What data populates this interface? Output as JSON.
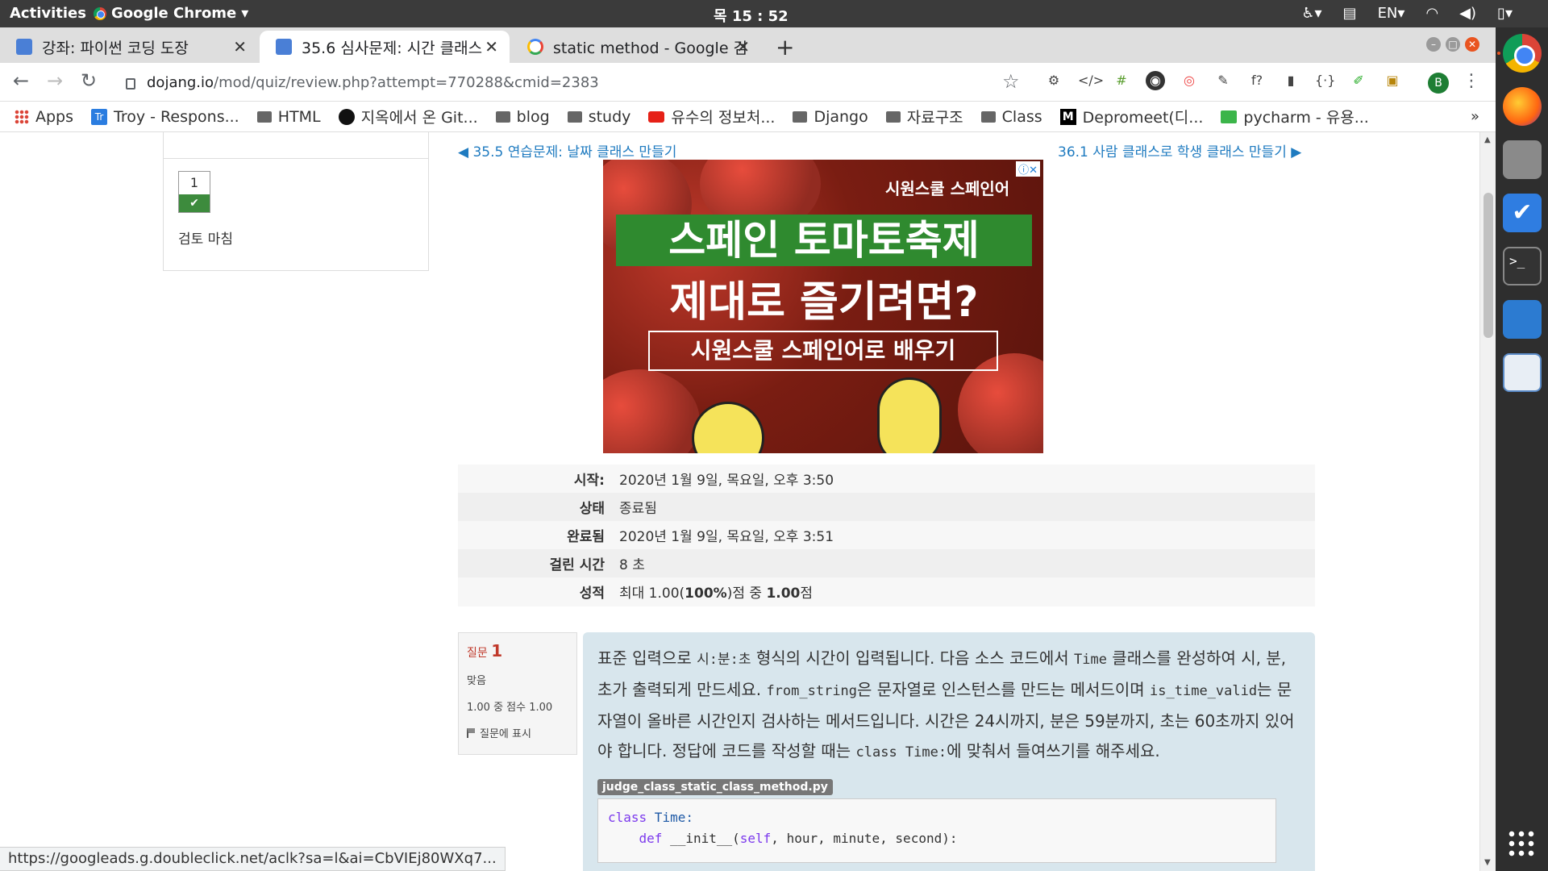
{
  "gnome": {
    "activities": "Activities",
    "app_name": "Google Chrome",
    "clock": "목 15 : 52",
    "lang": "EN"
  },
  "tabs": [
    {
      "title": "강좌: 파이썬 코딩 도장",
      "icon": "dojang-icon"
    },
    {
      "title": "35.6 심사문제: 시간 클래스",
      "icon": "dojang-icon"
    },
    {
      "title": "static method - Google 검",
      "icon": "google-icon"
    }
  ],
  "toolbar": {
    "url_host": "dojang.io",
    "url_path": "/mod/quiz/review.php?attempt=770288&cmid=2383",
    "profile_initial": "B"
  },
  "bookmarks": [
    {
      "label": "Apps"
    },
    {
      "label": "Troy - Respons..."
    },
    {
      "label": "HTML"
    },
    {
      "label": "지옥에서 온 Git..."
    },
    {
      "label": "blog"
    },
    {
      "label": "study"
    },
    {
      "label": "유수의 정보처..."
    },
    {
      "label": "Django"
    },
    {
      "label": "자료구조"
    },
    {
      "label": "Class"
    },
    {
      "label": "Depromeet(디..."
    },
    {
      "label": "pycharm - 유용..."
    }
  ],
  "bookmarks_more": "»",
  "quiz_nav": {
    "question_number": "1",
    "check": "✔",
    "finish_review": "검토 마침"
  },
  "pager": {
    "prev": "◀ 35.5 연습문제: 날짜 클래스 만들기",
    "next": "36.1 사람 클래스로 학생 클래스 만들기 ▶"
  },
  "ad": {
    "brand": "시원스쿨 스페인어",
    "line1": "스페인 토마토축제",
    "line2": "제대로 즐기려면?",
    "cta": "시원스쿨 스페인어로 배우기",
    "info": "ⓘ✕"
  },
  "summary": [
    {
      "key": "시작:",
      "value": "2020년 1월 9일, 목요일, 오후 3:50"
    },
    {
      "key": "상태",
      "value": "종료됨"
    },
    {
      "key": "완료됨",
      "value": "2020년 1월 9일, 목요일, 오후 3:51"
    },
    {
      "key": "걸린 시간",
      "value": "8 초"
    },
    {
      "key": "성적",
      "value_prefix": "최대 1.00(",
      "value_bold1": "100%",
      "value_mid": ")점 중 ",
      "value_bold2": "1.00",
      "value_suffix": "점"
    }
  ],
  "question": {
    "label": "질문",
    "number": "1",
    "state": "맞음",
    "score": "1.00 중 점수 1.00",
    "flag": "질문에 표시",
    "text_1": "표준 입력으로 ",
    "code_1": "시:분:초",
    "text_2": " 형식의 시간이 입력됩니다. 다음 소스 코드에서 ",
    "code_2": "Time",
    "text_3": " 클래스를 완성하여 시, 분, 초가 출력되게 만드세요. ",
    "code_3": "from_string",
    "text_4": "은 문자열로 인스턴스를 만드는 메서드이며 ",
    "code_4": "is_time_valid",
    "text_5": "는 문자열이 올바른 시간인지 검사하는 메서드입니다. 시간은 24시까지, 분은 59분까지, 초는 60초까지 있어야 합니다. 정답에 코드를 작성할 때는 ",
    "code_5": "class Time:",
    "text_6": "에 맞춰서 들여쓰기를 해주세요.",
    "filename": "judge_class_static_class_method.py",
    "code_line1_kw": "class",
    "code_line1_name": " Time:",
    "code_line2_kw": "    def",
    "code_line2_rest": " __init__(",
    "code_line2_self": "self",
    "code_line2_args": ", hour, minute, second):"
  },
  "status_url": "https://googleads.g.doubleclick.net/aclk?sa=l&ai=CbVIEj80WXq7..."
}
